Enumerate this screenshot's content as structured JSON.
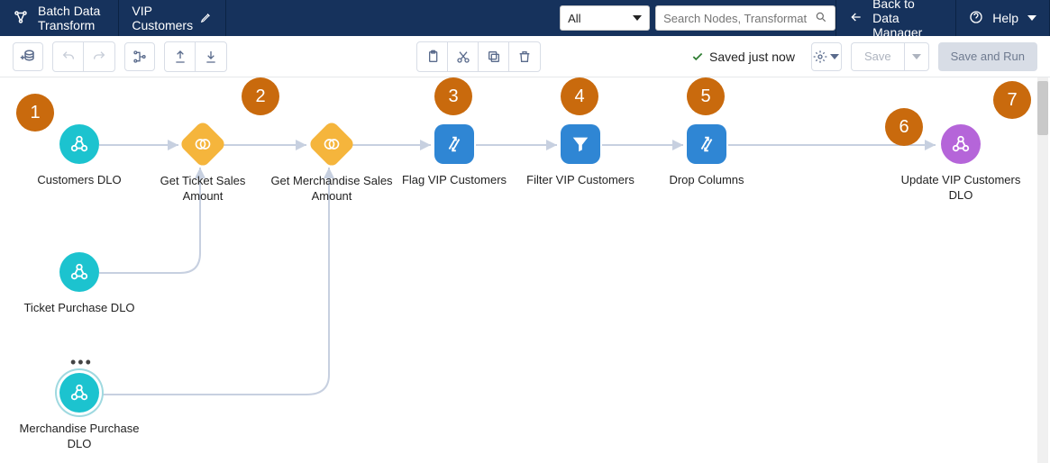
{
  "header": {
    "app_title": "Batch Data Transform",
    "doc_title": "VIP Customers",
    "filter_selected": "All",
    "search_placeholder": "Search Nodes, Transformat",
    "back_label": "Back to Data Manager",
    "help_label": "Help"
  },
  "toolbar": {
    "save_status": "Saved just now",
    "save_label": "Save",
    "save_run_label": "Save and Run"
  },
  "nodes": {
    "customers": "Customers DLO",
    "ticket_sales": "Get Ticket Sales Amount",
    "merch_sales": "Get Merchandise Sales Amount",
    "flag": "Flag VIP Customers",
    "filter": "Filter VIP Customers",
    "drop": "Drop Columns",
    "update": "Update VIP Customers DLO",
    "ticket_dlo": "Ticket Purchase DLO",
    "merch_dlo": "Merchandise Purchase DLO"
  },
  "annotations": {
    "a1": "1",
    "a2": "2",
    "a3": "3",
    "a4": "4",
    "a5": "5",
    "a6": "6",
    "a7": "7"
  }
}
